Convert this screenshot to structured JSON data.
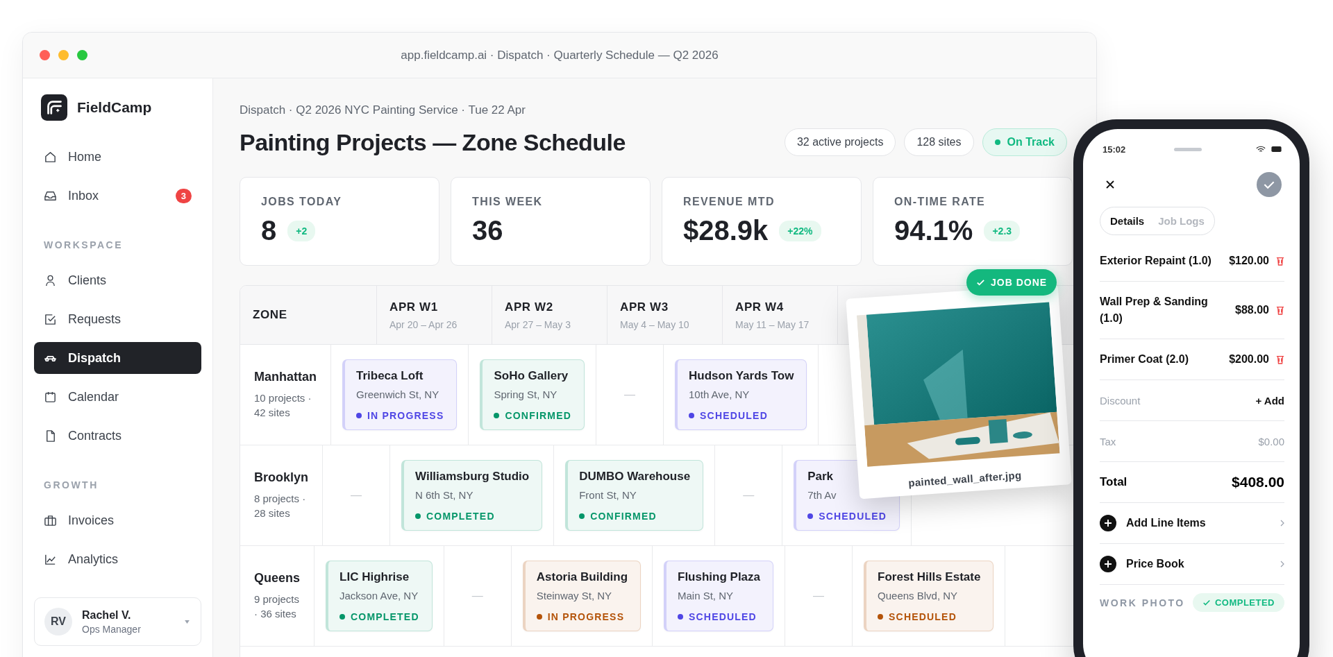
{
  "window": {
    "title": "app.fieldcamp.ai · Dispatch · Quarterly Schedule — Q2 2026"
  },
  "sidebar": {
    "brand": "FieldCamp",
    "sections": [
      {
        "items": [
          {
            "label": "Home",
            "selected": false
          },
          {
            "label": "Inbox",
            "selected": false,
            "badge": "3"
          }
        ]
      },
      {
        "heading": "WORKSPACE",
        "items": [
          {
            "label": "Clients",
            "selected": false
          },
          {
            "label": "Requests",
            "selected": false
          },
          {
            "label": "Dispatch",
            "selected": true
          },
          {
            "label": "Calendar",
            "selected": false
          },
          {
            "label": "Contracts",
            "selected": false
          }
        ]
      },
      {
        "heading": "GROWTH",
        "items": [
          {
            "label": "Invoices",
            "selected": false
          },
          {
            "label": "Analytics",
            "selected": false
          }
        ]
      }
    ],
    "user": {
      "initials": "RV",
      "name": "Rachel V.",
      "role": "Ops Manager"
    }
  },
  "header": {
    "breadcrumb": "Dispatch · Q2 2026 NYC Painting Service · Tue 22 Apr",
    "title": "Painting Projects — Zone Schedule",
    "pills": [
      {
        "label": "32 active projects",
        "kind": "count"
      },
      {
        "label": "128 sites",
        "kind": "count"
      },
      {
        "label": "On Track",
        "kind": "status",
        "color": "#10b981"
      }
    ]
  },
  "stats": [
    {
      "label": "JOBS TODAY",
      "value": "8",
      "delta": "+2"
    },
    {
      "label": "THIS WEEK",
      "value": "36"
    },
    {
      "label": "REVENUE MTD",
      "value": "$28.9k",
      "delta": "+22%"
    },
    {
      "label": "ON-TIME RATE",
      "value": "94.1%",
      "delta": "+2.3"
    }
  ],
  "schedule": {
    "zone_header": "ZONE",
    "weeks": [
      {
        "label": "APR W1",
        "dates": "Apr 20 – Apr 26"
      },
      {
        "label": "APR W2",
        "dates": "Apr 27 – May 3"
      },
      {
        "label": "APR W3",
        "dates": "May 4 – May 10"
      },
      {
        "label": "APR W4",
        "dates": "May 11 – May 17"
      }
    ],
    "lanes": [
      {
        "zone": "Manhattan",
        "meta": "10 projects · 42 sites",
        "items": [
          {
            "kind": "job",
            "title": "Tribeca Loft",
            "address": "Greenwich St, NY",
            "status": "IN PROGRESS",
            "color": "#4f46e5"
          },
          {
            "kind": "job",
            "title": "SoHo Gallery",
            "address": "Spring St, NY",
            "status": "CONFIRMED",
            "color": "#059669"
          },
          {
            "kind": "empty",
            "text": "—"
          },
          {
            "kind": "job",
            "title": "Hudson Yards Tow",
            "address": "10th Ave, NY",
            "status": "SCHEDULED",
            "color": "#4f46e5"
          }
        ]
      },
      {
        "zone": "Brooklyn",
        "meta": "8 projects · 28 sites",
        "items": [
          {
            "kind": "empty",
            "text": "—"
          },
          {
            "kind": "job",
            "title": "Williamsburg Studio",
            "address": "N 6th St, NY",
            "status": "COMPLETED",
            "color": "#059669"
          },
          {
            "kind": "job",
            "title": "DUMBO Warehouse",
            "address": "Front St, NY",
            "status": "CONFIRMED",
            "color": "#059669"
          },
          {
            "kind": "empty",
            "text": "—"
          },
          {
            "kind": "job",
            "title": "Park",
            "address": "7th Av",
            "status": "SCHEDULED",
            "color": "#4f46e5"
          }
        ]
      },
      {
        "zone": "Queens",
        "meta": "9 projects · 36 sites",
        "items": [
          {
            "kind": "job",
            "title": "LIC Highrise",
            "address": "Jackson Ave, NY",
            "status": "COMPLETED",
            "color": "#059669"
          },
          {
            "kind": "empty",
            "text": "—"
          },
          {
            "kind": "job",
            "title": "Astoria Building",
            "address": "Steinway St, NY",
            "status": "IN PROGRESS",
            "color": "#b45309"
          },
          {
            "kind": "job",
            "title": "Flushing Plaza",
            "address": "Main St, NY",
            "status": "SCHEDULED",
            "color": "#4f46e5"
          },
          {
            "kind": "empty",
            "text": "—"
          },
          {
            "kind": "job",
            "title": "Forest Hills Estate",
            "address": "Queens Blvd, NY",
            "status": "SCHEDULED",
            "color": "#b45309"
          }
        ]
      }
    ]
  },
  "photo": {
    "badge": "JOB DONE",
    "caption": "painted_wall_after.jpg"
  },
  "phone": {
    "time": "15:02",
    "tabs": [
      {
        "label": "Details",
        "selected": true
      },
      {
        "label": "Job Logs",
        "selected": false
      }
    ],
    "line_items": [
      {
        "name": "Exterior Repaint (1.0)",
        "price": "$120.00"
      },
      {
        "name": "Wall Prep & Sanding (1.0)",
        "price": "$88.00"
      },
      {
        "name": "Primer Coat (2.0)",
        "price": "$200.00"
      }
    ],
    "discount": {
      "label": "Discount",
      "action": "+ Add"
    },
    "tax": {
      "label": "Tax",
      "value": "$0.00"
    },
    "total": {
      "label": "Total",
      "value": "$408.00"
    },
    "links": [
      {
        "label": "Add Line Items"
      },
      {
        "label": "Price Book"
      }
    ],
    "work_photo": {
      "label": "WORK PHOTO",
      "status": "COMPLETED"
    }
  }
}
